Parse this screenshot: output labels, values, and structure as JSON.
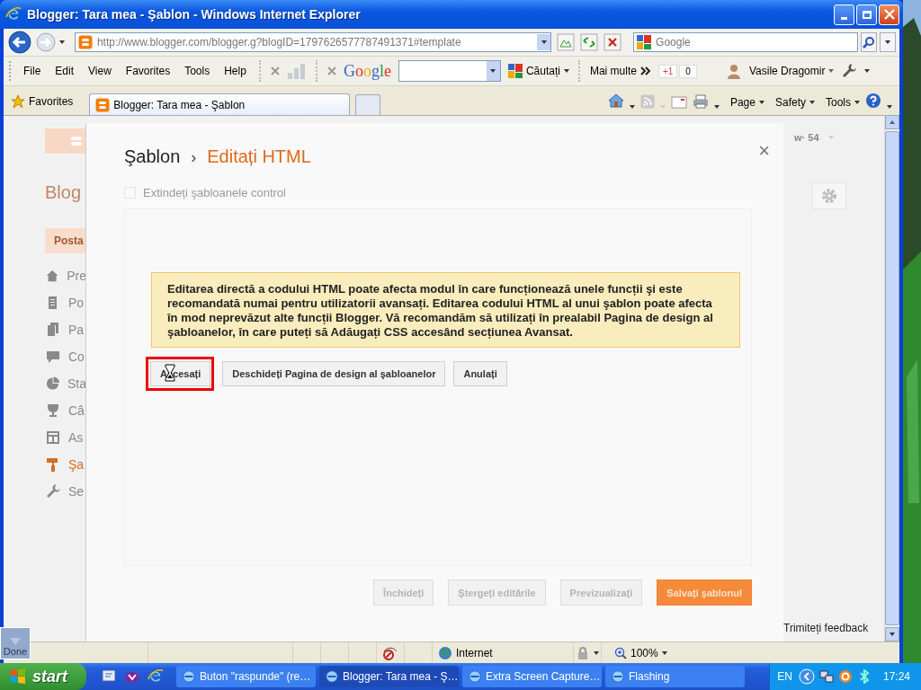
{
  "window": {
    "title": "Blogger: Tara mea - Şablon - Windows Internet Explorer"
  },
  "address_bar": {
    "url": "http://www.blogger.com/blogger.g?blogID=1797626577787491371#template"
  },
  "search_box": {
    "placeholder": "Google"
  },
  "menu": [
    "File",
    "Edit",
    "View",
    "Favorites",
    "Tools",
    "Help"
  ],
  "google_toolbar": {
    "logo": "Google",
    "search_button": "Căutați",
    "more": "Mai multe",
    "plus_one": "+1",
    "plus_count": "0",
    "user": "Vasile Dragomir"
  },
  "favorites_bar": {
    "favorites": "Favorites",
    "tabs": [
      {
        "label": "Blogger: Tara mea - Şablon",
        "selected": true
      }
    ],
    "commands": [
      "Page",
      "Safety",
      "Tools"
    ]
  },
  "background_page": {
    "title": "Blog",
    "new_post": "Posta",
    "counter": "w· 54",
    "feedback": "Trimiteți feedback",
    "nav": [
      {
        "label": "Pre",
        "selected": false
      },
      {
        "label": "Po",
        "selected": false
      },
      {
        "label": "Pa",
        "selected": false
      },
      {
        "label": "Co",
        "selected": false
      },
      {
        "label": "Sta",
        "selected": false
      },
      {
        "label": "Câ",
        "selected": false
      },
      {
        "label": "As",
        "selected": false
      },
      {
        "label": "Şa",
        "selected": true
      },
      {
        "label": "Se",
        "selected": false
      }
    ]
  },
  "dialog": {
    "breadcrumb": "Şablon",
    "separator": "›",
    "title": "Editați HTML",
    "close": "×",
    "expand_widgets": {
      "label": "Extindeți şabloanele control",
      "checked": false
    },
    "warning": "Editarea directă a codului HTML poate afecta modul în care funcționează unele funcții şi este recomandată numai pentru utilizatorii avansați. Editarea codului HTML al unui şablon poate afecta în mod neprevăzut alte funcții Blogger. Vă recomandăm să utilizați în prealabil Pagina de design al şabloanelor, în care puteți să Adăugați CSS accesând secțiunea Avansat.",
    "actions": [
      {
        "label": "Accesați",
        "highlighted": true
      },
      {
        "label": "Deschideți Pagina de design al şabloanelor",
        "highlighted": false
      },
      {
        "label": "Anulați",
        "highlighted": false
      }
    ],
    "footer_buttons": [
      {
        "label": "Închideți",
        "kind": "plain",
        "disabled": true
      },
      {
        "label": "Ştergeți editările",
        "kind": "plain",
        "disabled": true
      },
      {
        "label": "Previzualizați",
        "kind": "plain",
        "disabled": true
      },
      {
        "label": "Salvați şablonul",
        "kind": "primary",
        "disabled": true
      }
    ]
  },
  "capture_overlay": {
    "label": "Done"
  },
  "status_bar": {
    "zone": "Internet",
    "zoom": "100%"
  },
  "taskbar": {
    "start": "start",
    "tasks": [
      {
        "label": "Buton \"raspunde\" (re…",
        "selected": false
      },
      {
        "label": "Blogger: Tara mea - Ş…",
        "selected": true
      },
      {
        "label": "Extra Screen Capture…",
        "selected": false
      },
      {
        "label": "Flashing",
        "selected": false
      }
    ],
    "language": "EN",
    "clock": "17:24"
  }
}
